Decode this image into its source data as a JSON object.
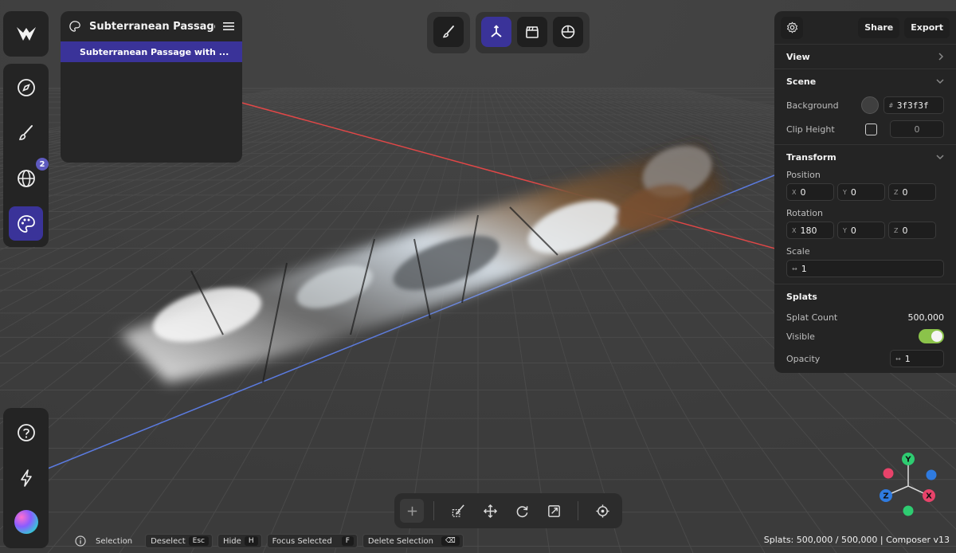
{
  "outliner": {
    "title": "Subterranean Passage ...",
    "items": [
      {
        "label": "Subterranean Passage with ..."
      }
    ]
  },
  "nav": {
    "badge_count": "2"
  },
  "props": {
    "share_label": "Share",
    "export_label": "Export",
    "view": {
      "title": "View"
    },
    "scene": {
      "title": "Scene",
      "background_label": "Background",
      "background_hex": "3f3f3f",
      "hex_prefix": "#",
      "clip_height_label": "Clip Height",
      "clip_height_value": "0"
    },
    "transform": {
      "title": "Transform",
      "position_label": "Position",
      "position": {
        "x": "0",
        "y": "0",
        "z": "0"
      },
      "rotation_label": "Rotation",
      "rotation": {
        "x": "180",
        "y": "0",
        "z": "0"
      },
      "scale_label": "Scale",
      "scale": "1",
      "axis_x": "X",
      "axis_y": "Y",
      "axis_z": "Z"
    },
    "splats": {
      "title": "Splats",
      "count_label": "Splat Count",
      "count_value": "500,000",
      "visible_label": "Visible",
      "visible": true,
      "opacity_label": "Opacity",
      "opacity_value": "1"
    }
  },
  "status": {
    "selection_label": "Selection",
    "deselect_label": "Deselect",
    "deselect_key": "Esc",
    "hide_label": "Hide",
    "hide_key": "H",
    "focus_label": "Focus Selected",
    "focus_key": "F",
    "delete_label": "Delete Selection",
    "splats_summary": "Splats: 500,000 / 500,000 | Composer v13"
  },
  "gizmo": {
    "y": "Y",
    "x": "X",
    "z": "Z"
  },
  "colors": {
    "accent": "#3a3399",
    "background": "#3f3f3f",
    "toggle_on": "#8bc34a",
    "axis_x": "#e8436a",
    "axis_y": "#2ecc71",
    "axis_z": "#2f7be0"
  }
}
